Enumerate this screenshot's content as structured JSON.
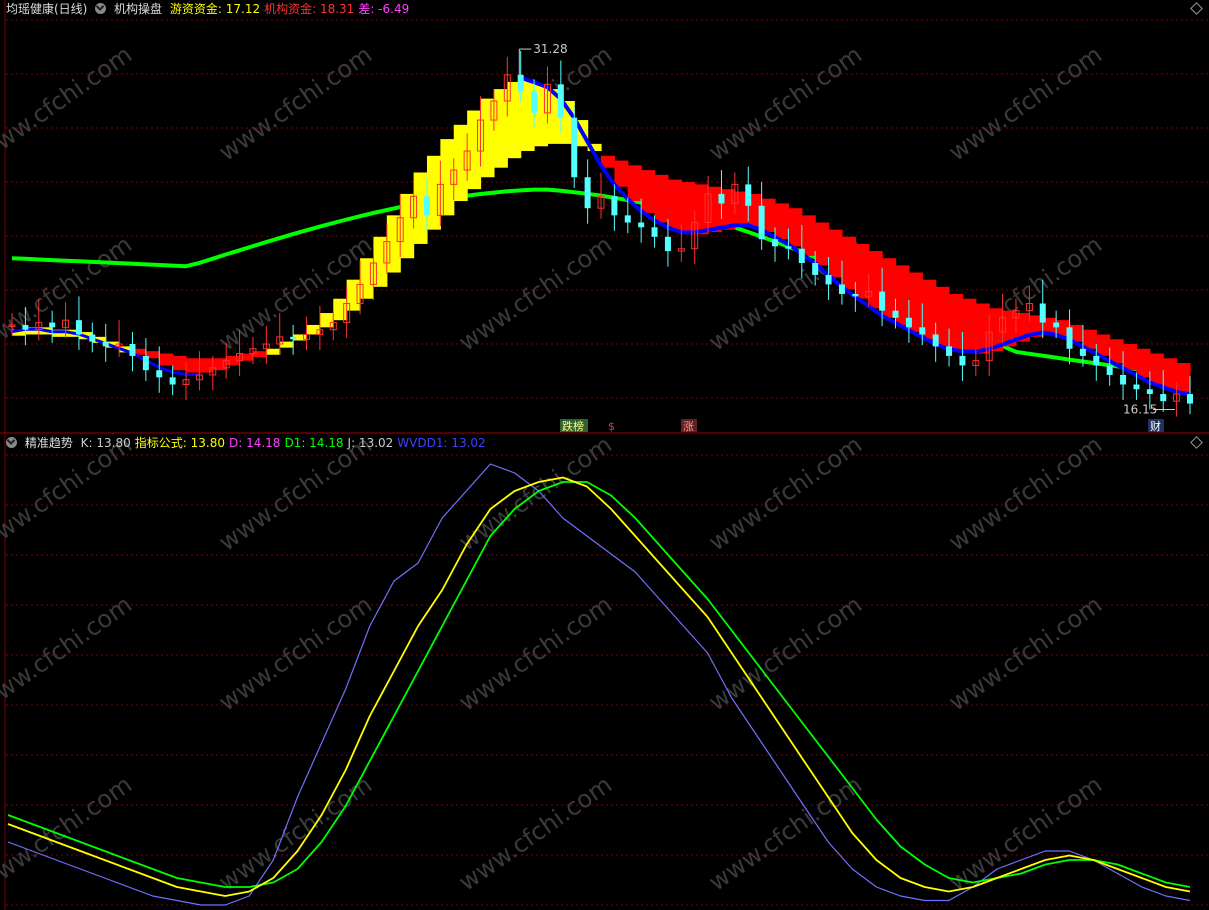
{
  "header_top": {
    "stock_name": "均瑶健康(日线)",
    "indicator_name": "机构操盘",
    "items": [
      {
        "label": "游资资金",
        "value": "17.12",
        "color": "#ffff00"
      },
      {
        "label": "机构资金",
        "value": "18.31",
        "color": "#ff3030"
      },
      {
        "label": "差",
        "value": "-6.49",
        "color": "#ff40ff"
      }
    ]
  },
  "header_bottom": {
    "indicator_name": "精准趋势",
    "items": [
      {
        "label": "K",
        "value": "13.80",
        "color": "#cccccc"
      },
      {
        "label": "指标公式",
        "value": "13.80",
        "color": "#ffff00"
      },
      {
        "label": "D",
        "value": "14.18",
        "color": "#ff40ff"
      },
      {
        "label": "D1",
        "value": "14.18",
        "color": "#00ff00"
      },
      {
        "label": "J",
        "value": "13.02",
        "color": "#cccccc"
      },
      {
        "label": "WVDD1",
        "value": "13.02",
        "color": "#4040ff"
      }
    ]
  },
  "annotations": {
    "high_label": "31.28",
    "low_label": "16.15",
    "signal_1": "跌榜",
    "signal_2": "$",
    "signal_3": "涨",
    "signal_4": "财"
  },
  "watermark": "www.cfchi.com",
  "colors": {
    "up": "#ff3030",
    "down": "#54ffff",
    "ribbon_yellow": "#ffff00",
    "ribbon_red": "#ff0000",
    "ma_green": "#00ff00",
    "ma_blue": "#0000ff",
    "grid": "#800000",
    "k_line": "#ffff00",
    "d_line": "#00ff00",
    "j_line": "#7070ff"
  },
  "chart_data": [
    {
      "type": "candlestick",
      "title": "均瑶健康(日线)",
      "ylim": [
        15.5,
        32.5
      ],
      "high": 31.28,
      "low": 16.15,
      "close_series": [
        19.7,
        19.5,
        19.8,
        19.6,
        19.9,
        19.3,
        19.0,
        18.8,
        18.9,
        18.4,
        17.8,
        17.5,
        17.2,
        17.4,
        17.6,
        17.9,
        18.2,
        18.5,
        18.7,
        18.9,
        19.2,
        19.1,
        19.3,
        19.5,
        19.8,
        20.6,
        21.4,
        22.3,
        23.2,
        24.2,
        25.1,
        24.3,
        25.6,
        26.2,
        27.0,
        28.3,
        29.1,
        30.2,
        29.5,
        28.6,
        29.8,
        28.4,
        25.9,
        24.6,
        25.1,
        24.3,
        24.0,
        23.8,
        23.4,
        22.8,
        22.9,
        24.0,
        25.2,
        24.8,
        25.6,
        24.7,
        23.3,
        23.0,
        22.9,
        22.3,
        21.8,
        21.4,
        21.0,
        20.9,
        21.1,
        20.3,
        20.0,
        19.6,
        19.3,
        18.8,
        18.4,
        18.0,
        18.2,
        19.4,
        20.0,
        20.3,
        20.6,
        19.8,
        19.6,
        18.7,
        18.4,
        18.0,
        17.6,
        17.2,
        17.0,
        16.8,
        16.5,
        16.8,
        16.4
      ],
      "series": [
        {
          "name": "游资资金",
          "values": [
            19.5,
            19.6,
            19.6,
            19.5,
            19.5,
            19.4,
            19.2,
            19.0,
            18.8,
            18.6,
            18.3,
            18.0,
            17.8,
            17.7,
            17.7,
            17.8,
            18.0,
            18.2,
            18.4,
            18.7,
            19.0,
            19.3,
            19.7,
            20.2,
            20.8,
            21.6,
            22.5,
            23.4,
            24.3,
            25.2,
            26.1,
            26.8,
            27.5,
            28.1,
            28.7,
            29.2,
            29.6,
            29.9,
            30.0,
            29.8,
            29.6,
            29.1,
            28.3,
            27.3,
            26.3,
            25.5,
            24.9,
            24.4,
            24.0,
            23.7,
            23.5,
            23.5,
            23.6,
            23.7,
            23.8,
            23.8,
            23.6,
            23.3,
            23.0,
            22.6,
            22.2,
            21.7,
            21.2,
            20.8,
            20.4,
            20.0,
            19.7,
            19.4,
            19.1,
            18.8,
            18.6,
            18.5,
            18.5,
            18.6,
            18.8,
            19.0,
            19.2,
            19.3,
            19.2,
            19.0,
            18.7,
            18.4,
            18.1,
            17.8,
            17.5,
            17.2,
            17.0,
            16.8,
            16.7
          ]
        },
        {
          "name": "机构资金",
          "values": [
            19.3,
            19.3,
            19.3,
            19.2,
            19.2,
            19.1,
            19.0,
            18.9,
            18.8,
            18.7,
            18.6,
            18.5,
            18.4,
            18.3,
            18.3,
            18.3,
            18.4,
            18.5,
            18.6,
            18.7,
            18.9,
            19.1,
            19.3,
            19.6,
            19.9,
            20.3,
            20.8,
            21.3,
            21.9,
            22.5,
            23.1,
            23.7,
            24.3,
            24.9,
            25.4,
            25.9,
            26.3,
            26.7,
            27.0,
            27.2,
            27.3,
            27.3,
            27.2,
            27.0,
            26.8,
            26.6,
            26.4,
            26.2,
            26.0,
            25.8,
            25.7,
            25.6,
            25.5,
            25.4,
            25.3,
            25.2,
            25.0,
            24.8,
            24.6,
            24.3,
            24.0,
            23.7,
            23.4,
            23.1,
            22.8,
            22.5,
            22.2,
            21.9,
            21.6,
            21.3,
            21.0,
            20.8,
            20.6,
            20.4,
            20.3,
            20.2,
            20.1,
            20.0,
            19.9,
            19.7,
            19.5,
            19.3,
            19.1,
            18.9,
            18.7,
            18.5,
            18.3,
            18.1,
            17.9
          ]
        }
      ]
    },
    {
      "type": "line",
      "title": "精准趋势",
      "ylim": [
        0,
        100
      ],
      "series": [
        {
          "name": "K",
          "values": [
            18,
            16,
            14,
            12,
            10,
            8,
            6,
            4,
            3,
            2,
            3,
            6,
            12,
            20,
            30,
            42,
            52,
            62,
            70,
            80,
            88,
            92,
            94,
            95,
            93,
            88,
            82,
            76,
            70,
            64,
            56,
            48,
            40,
            32,
            24,
            16,
            10,
            6,
            4,
            3,
            4,
            6,
            8,
            10,
            11,
            10,
            8,
            6,
            4,
            3
          ]
        },
        {
          "name": "D",
          "values": [
            20,
            18,
            16,
            14,
            12,
            10,
            8,
            6,
            5,
            4,
            4,
            5,
            8,
            14,
            22,
            32,
            42,
            52,
            62,
            72,
            82,
            88,
            92,
            94,
            94,
            91,
            86,
            80,
            74,
            68,
            61,
            54,
            47,
            40,
            33,
            26,
            19,
            13,
            9,
            6,
            5,
            6,
            7,
            9,
            10,
            10,
            9,
            7,
            5,
            4
          ]
        },
        {
          "name": "J",
          "values": [
            14,
            12,
            10,
            8,
            6,
            4,
            2,
            1,
            0,
            0,
            2,
            10,
            24,
            36,
            48,
            62,
            72,
            76,
            86,
            92,
            98,
            96,
            92,
            86,
            82,
            78,
            74,
            68,
            62,
            56,
            46,
            38,
            30,
            22,
            14,
            8,
            4,
            2,
            1,
            1,
            4,
            8,
            10,
            12,
            12,
            10,
            7,
            4,
            2,
            1
          ]
        }
      ]
    }
  ]
}
